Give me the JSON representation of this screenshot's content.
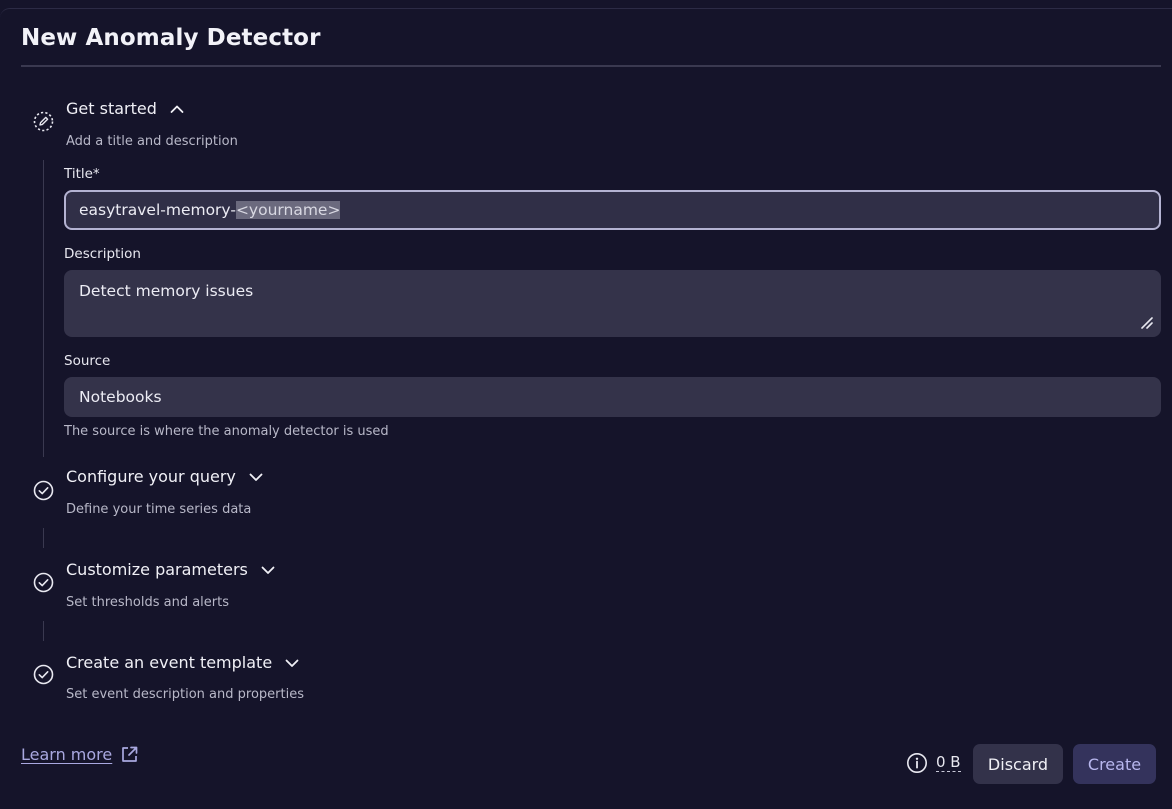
{
  "header": {
    "title": "New Anomaly Detector"
  },
  "steps": [
    {
      "title": "Get started",
      "subtitle": "Add a title and description",
      "expanded": true,
      "icon": "dashed-circle-edit-icon"
    },
    {
      "title": "Configure your query",
      "subtitle": "Define your time series data",
      "expanded": false,
      "icon": "check-circle-icon"
    },
    {
      "title": "Customize parameters",
      "subtitle": "Set thresholds and alerts",
      "expanded": false,
      "icon": "check-circle-icon"
    },
    {
      "title": "Create an event template",
      "subtitle": "Set event description and properties",
      "expanded": false,
      "icon": "check-circle-icon"
    }
  ],
  "form": {
    "title_label": "Title*",
    "title_value_prefix": "easytravel-memory-",
    "title_value_selected": "<yourname>",
    "description_label": "Description",
    "description_value": "Detect memory issues",
    "source_label": "Source",
    "source_value": "Notebooks",
    "source_hint": "The source is where the anomaly detector is used"
  },
  "footer": {
    "learn_more": "Learn more",
    "size": "0 B",
    "discard_label": "Discard",
    "create_label": "Create"
  },
  "colors": {
    "background": "#15142a",
    "input": "#34334a",
    "accent": "#a9a8e0",
    "create_button": "#34335c"
  }
}
